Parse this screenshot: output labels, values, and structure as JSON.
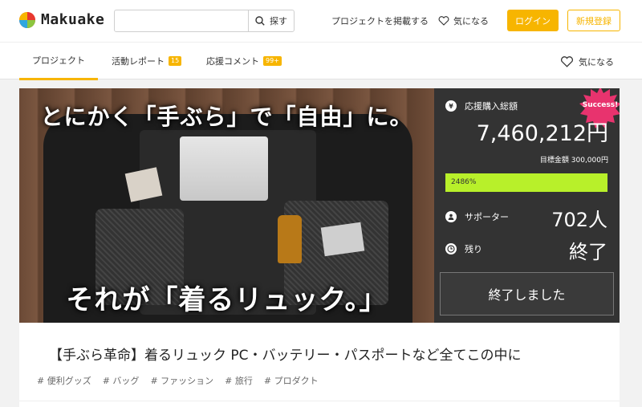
{
  "header": {
    "logo_text": "Makuake",
    "search_placeholder": "",
    "search_button": "探す",
    "post_project": "プロジェクトを掲載する",
    "favorite": "気になる",
    "login": "ログイン",
    "register": "新規登録"
  },
  "tabs": {
    "items": [
      {
        "label": "プロジェクト",
        "badge": ""
      },
      {
        "label": "活動レポート",
        "badge": "15"
      },
      {
        "label": "応援コメント",
        "badge": "99+"
      }
    ],
    "favorite": "気になる"
  },
  "hero": {
    "caption_top": "とにかく「手ぶら」で「自由」に。",
    "caption_bottom": "それが「着るリュック。」"
  },
  "panel": {
    "success_badge": "Success!",
    "total_label": "応援購入総額",
    "total_value": "7,460,212円",
    "goal_text": "目標金額 300,000円",
    "progress_text": "2486%",
    "progress_fraction": 1.0,
    "supporters_label": "サポーター",
    "supporters_value": "702人",
    "remaining_label": "残り",
    "remaining_value": "終了",
    "status_button": "終了しました"
  },
  "project": {
    "title": "【手ぶら革命】着るリュック PC・バッテリー・パスポートなど全てこの中に",
    "tags": [
      "# 便利グッズ",
      "# バッグ",
      "# ファッション",
      "# 旅行",
      "# プロダクト"
    ]
  },
  "colors": {
    "accent": "#f7b500",
    "panel_bg": "#333333",
    "progress": "#b8f02a",
    "success_badge": "#e8336e"
  }
}
